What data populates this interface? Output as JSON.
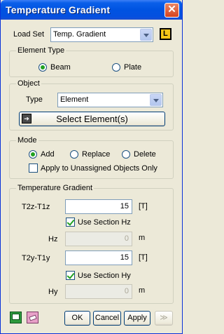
{
  "window": {
    "title": "Temperature Gradient"
  },
  "load_set": {
    "label": "Load Set",
    "value": "Temp. Gradient"
  },
  "element_type": {
    "title": "Element Type",
    "options": [
      {
        "label": "Beam",
        "selected": true
      },
      {
        "label": "Plate",
        "selected": false
      }
    ]
  },
  "object": {
    "title": "Object",
    "type_label": "Type",
    "type_value": "Element",
    "select_button": "Select Element(s)"
  },
  "mode": {
    "title": "Mode",
    "options": [
      {
        "label": "Add",
        "selected": true
      },
      {
        "label": "Replace",
        "selected": false
      },
      {
        "label": "Delete",
        "selected": false
      }
    ],
    "apply_unassigned": {
      "label": "Apply to Unassigned Objects Only",
      "checked": false
    }
  },
  "temperature_gradient": {
    "title": "Temperature Gradient",
    "t2z": {
      "label": "T2z-T1z",
      "value": "15",
      "unit": "[T]"
    },
    "use_section_hz": {
      "label": "Use Section Hz",
      "checked": true
    },
    "hz": {
      "label": "Hz",
      "value": "0",
      "unit": "m"
    },
    "t2y": {
      "label": "T2y-T1y",
      "value": "15",
      "unit": "[T]"
    },
    "use_section_hy": {
      "label": "Use Section Hy",
      "checked": true
    },
    "hy": {
      "label": "Hy",
      "value": "0",
      "unit": "m"
    }
  },
  "footer": {
    "ok": "OK",
    "cancel": "Cancel",
    "apply": "Apply",
    "more": "≫"
  },
  "colors": {
    "titlebar": "#0053e1",
    "accent_check": "#21a121",
    "l_icon_bg": "#f5c518"
  }
}
